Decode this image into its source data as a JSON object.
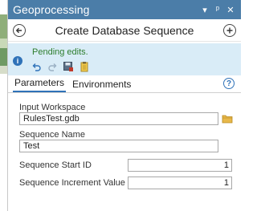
{
  "window": {
    "title": "Geoprocessing",
    "controls": [
      "▾",
      "ᵖ",
      "✕"
    ]
  },
  "header": {
    "back_icon": "back-arrow-icon",
    "tool_title": "Create Database Sequence",
    "add_icon": "plus-icon"
  },
  "info": {
    "icon": "info-icon",
    "message": "Pending edits.",
    "edit_tools": [
      "undo-icon",
      "redo-icon",
      "save-edits-icon",
      "discard-edits-icon"
    ]
  },
  "tabs": [
    {
      "label": "Parameters",
      "active": true
    },
    {
      "label": "Environments",
      "active": false
    }
  ],
  "help_label": "?",
  "params": {
    "input_workspace": {
      "label": "Input Workspace",
      "value": "RulesTest.gdb"
    },
    "sequence_name": {
      "label": "Sequence Name",
      "value": "Test"
    },
    "start_id": {
      "label": "Sequence Start ID",
      "value": "1"
    },
    "increment": {
      "label": "Sequence Increment Value",
      "value": "1"
    }
  },
  "colors": {
    "titlebar": "#4b7da8",
    "info_bar": "#d9ecf7",
    "pending_text": "#2d7d2d",
    "accent": "#2f72b8"
  }
}
